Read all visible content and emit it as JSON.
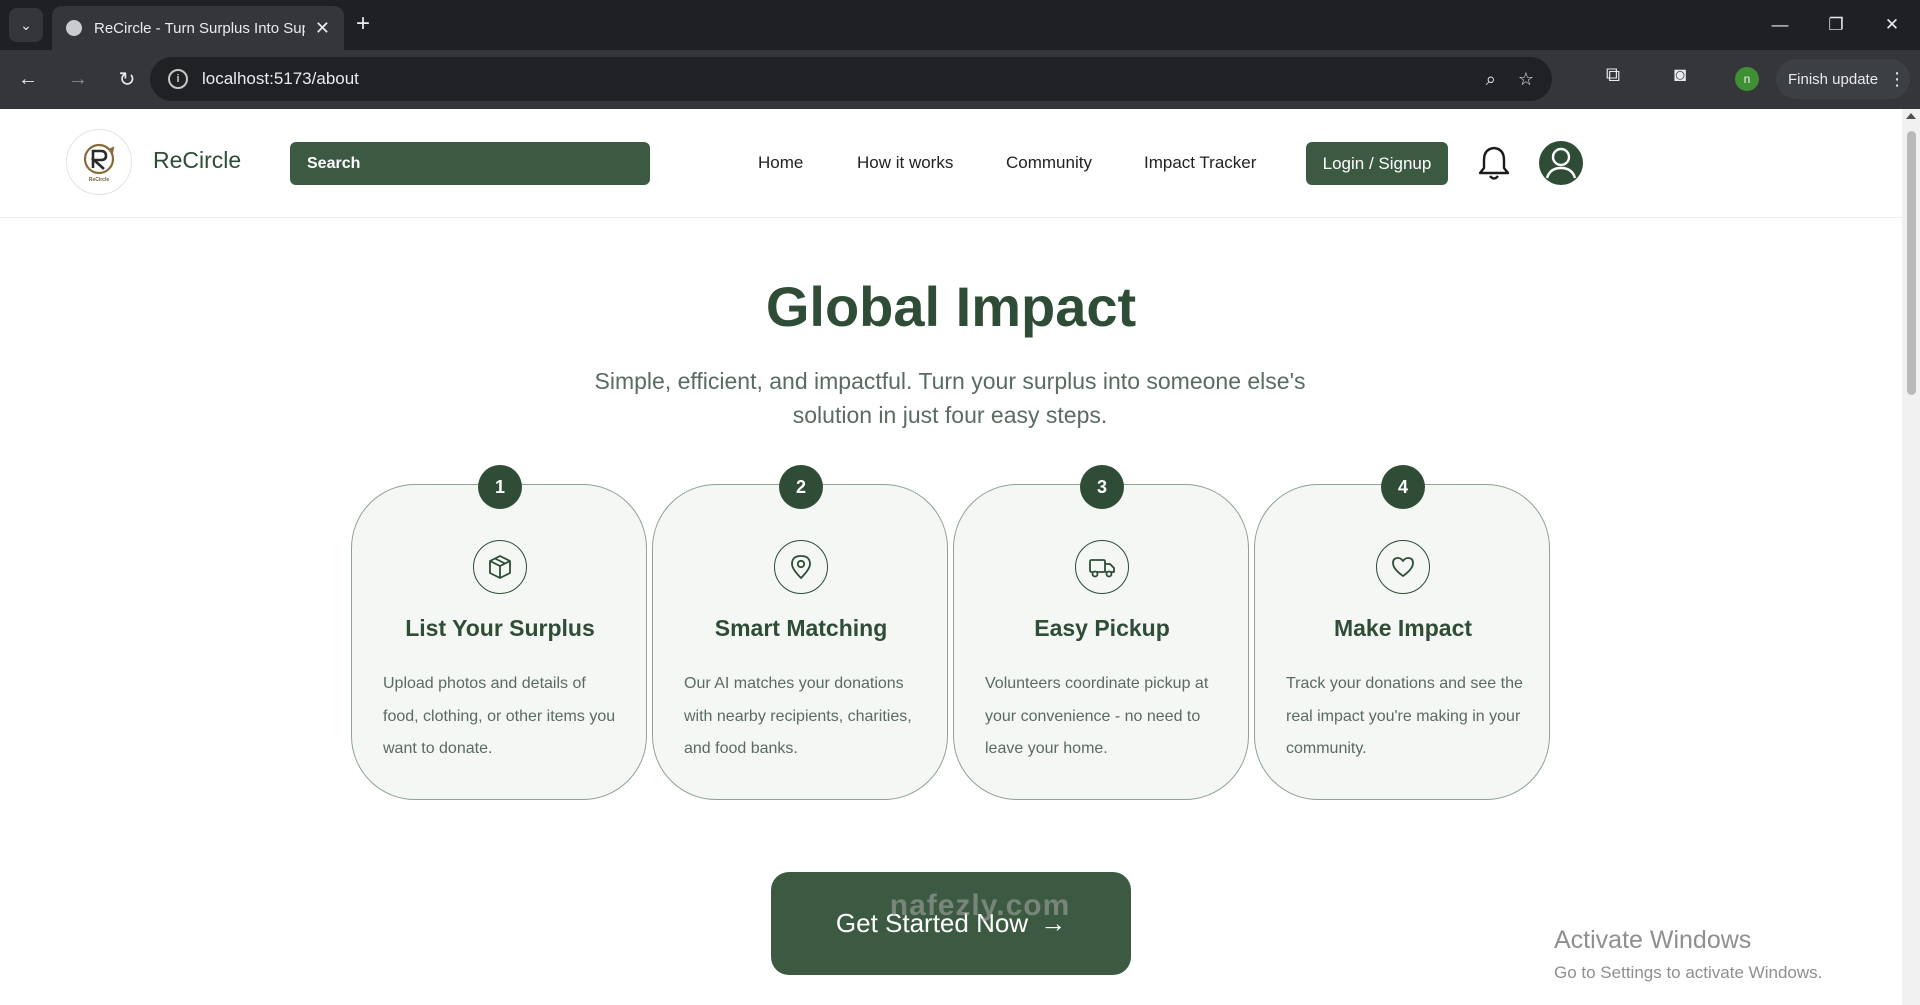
{
  "browser": {
    "tab_title": "ReCircle - Turn Surplus Into Sup",
    "url": "localhost:5173/about",
    "finish_update_label": "Finish update",
    "profile_initial": "n"
  },
  "site": {
    "brand": "ReCircle",
    "logo_text": "ReCircle",
    "search_placeholder": "Search",
    "nav": [
      "Home",
      "How it works",
      "Community",
      "Impact Tracker"
    ],
    "login_label": "Login / Signup"
  },
  "hero": {
    "title": "Global Impact",
    "subtitle": "Simple, efficient, and impactful. Turn your surplus into someone else's solution in just four easy steps."
  },
  "steps": [
    {
      "number": "1",
      "icon": "box-icon",
      "title": "List Your Surplus",
      "text": "Upload photos and details of food, clothing, or other items you want to donate."
    },
    {
      "number": "2",
      "icon": "location-pin-icon",
      "title": "Smart Matching",
      "text": "Our AI matches your donations with nearby recipients, charities, and food banks."
    },
    {
      "number": "3",
      "icon": "truck-icon",
      "title": "Easy Pickup",
      "text": "Volunteers coordinate pickup at your convenience - no need to leave your home."
    },
    {
      "number": "4",
      "icon": "heart-icon",
      "title": "Make Impact",
      "text": "Track your donations and see the real impact you're making in your community."
    }
  ],
  "cta": {
    "label": "Get Started Now",
    "arrow": "→"
  },
  "watermark": "nafezly.com",
  "os_notice": {
    "line1": "Activate Windows",
    "line2": "Go to Settings to activate Windows."
  },
  "colors": {
    "brand_green": "#2e4c36",
    "button_green": "#3c5a42",
    "card_bg": "#f4f7f4"
  }
}
